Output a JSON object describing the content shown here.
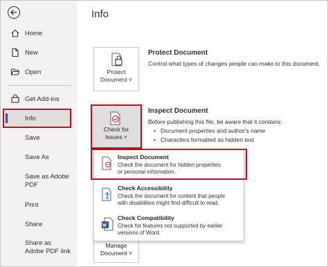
{
  "sidebar": {
    "items": [
      {
        "label": "Home",
        "icon": "home-icon"
      },
      {
        "label": "New",
        "icon": "new-document-icon"
      },
      {
        "label": "Open",
        "icon": "folder-open-icon"
      },
      {
        "label": "Get Add-ins",
        "icon": "store-icon"
      },
      {
        "label": "Info"
      },
      {
        "label": "Save"
      },
      {
        "label": "Save As"
      },
      {
        "label": "Save as Adobe PDF"
      },
      {
        "label": "Print"
      },
      {
        "label": "Share"
      },
      {
        "label": "Share as Adobe PDF link"
      }
    ]
  },
  "main": {
    "title": "Info",
    "protect": {
      "button_line1": "Protect",
      "button_line2": "Document ˅",
      "title": "Protect Document",
      "description": "Control what types of changes people can make to this document."
    },
    "inspect": {
      "button_line1": "Check for",
      "button_line2": "Issues ˅",
      "title": "Inspect Document",
      "description": "Before publishing this file, be aware that it contains:",
      "bullet1": "Document properties and author's name",
      "bullet2": "Characters formatted as hidden text"
    },
    "dropdown": [
      {
        "title": "Inspect Document",
        "line1": "Check the document for hidden properties",
        "line2": "or personal information."
      },
      {
        "title": "Check Accessibility",
        "line1": "Check the document for content that people",
        "line2": "with disabilities might find difficult to read."
      },
      {
        "title": "Check Compatibility",
        "line1": "Check for features not supported by earlier",
        "line2": "versions of Word."
      }
    ],
    "manage": {
      "button_line1": "Manage",
      "button_line2": "Document ˅"
    }
  },
  "colors": {
    "highlight": "#d0021b",
    "accent": "#2b579a",
    "sidebar": "#f3f2f1"
  }
}
